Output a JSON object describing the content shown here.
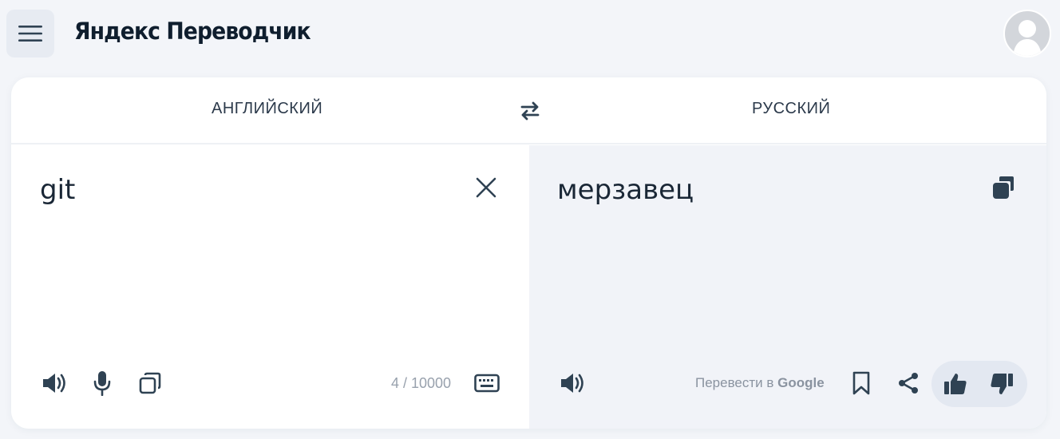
{
  "app": {
    "title": "Яндекс Переводчик"
  },
  "header": {
    "menu_icon": "hamburger-menu-icon",
    "avatar_icon": "user-avatar-icon"
  },
  "languages": {
    "source": "АНГЛИЙСКИЙ",
    "target": "РУССКИЙ",
    "swap_icon": "swap-arrows-icon"
  },
  "source_pane": {
    "text": "git",
    "counter": "4 / 10000",
    "icons": [
      "clear-icon",
      "speaker-icon",
      "microphone-icon",
      "copy-icon",
      "keyboard-icon"
    ]
  },
  "target_pane": {
    "text": "мерзавец",
    "google_prefix": "Перевести в ",
    "google_brand": "Google",
    "icons": [
      "copy-icon",
      "speaker-icon",
      "bookmark-icon",
      "share-icon",
      "thumbs-up-icon",
      "thumbs-down-icon"
    ]
  },
  "colors": {
    "page_bg": "#f3f5f9",
    "card_bg": "#ffffff",
    "target_bg": "#f1f3f8",
    "icon": "#2f4253",
    "muted": "#98a1ad"
  }
}
